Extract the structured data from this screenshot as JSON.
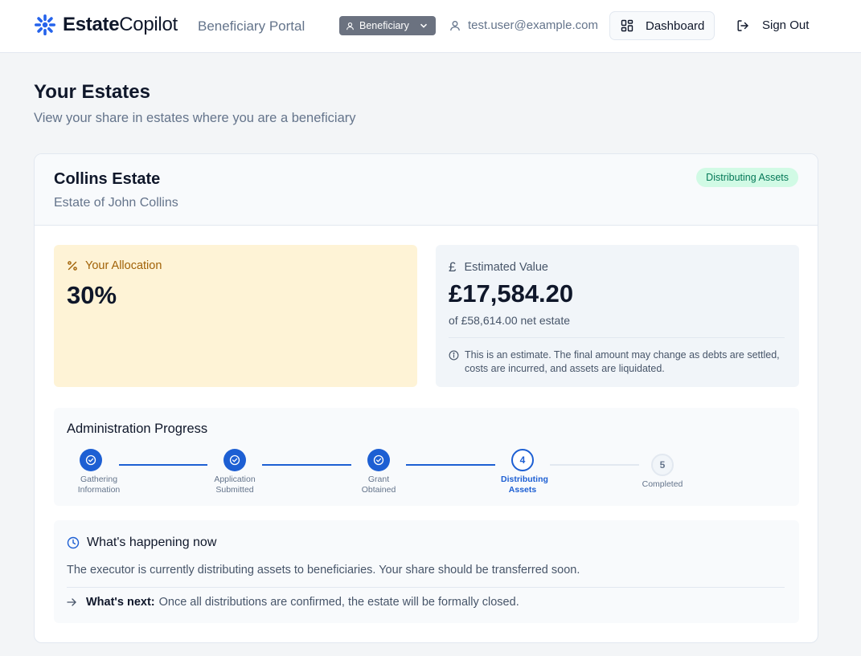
{
  "header": {
    "logo_bold": "Estate",
    "logo_light": "Copilot",
    "portal_label": "Beneficiary Portal",
    "role_label": "Beneficiary",
    "user_email": "test.user@example.com",
    "dashboard_label": "Dashboard",
    "signout_label": "Sign Out"
  },
  "page": {
    "title": "Your Estates",
    "subtitle": "View your share in estates where you are a beneficiary"
  },
  "estate": {
    "name": "Collins Estate",
    "of": "Estate of John Collins",
    "status": "Distributing Assets",
    "allocation": {
      "label": "Your Allocation",
      "value": "30%"
    },
    "estimated": {
      "label": "Estimated Value",
      "amount": "£17,584.20",
      "net": "of £58,614.00 net estate",
      "note": "This is an estimate. The final amount may change as debts are settled, costs are incurred, and assets are liquidated."
    },
    "progress": {
      "title": "Administration Progress",
      "steps": [
        {
          "num": "1",
          "label": "Gathering Information",
          "state": "done"
        },
        {
          "num": "2",
          "label": "Application Submitted",
          "state": "done"
        },
        {
          "num": "3",
          "label": "Grant Obtained",
          "state": "done"
        },
        {
          "num": "4",
          "label": "Distributing Assets",
          "state": "current"
        },
        {
          "num": "5",
          "label": "Completed",
          "state": "todo"
        }
      ]
    },
    "happening": {
      "title": "What's happening now",
      "body": "The executor is currently distributing assets to beneficiaries. Your share should be transferred soon.",
      "next_label": "What's next:",
      "next_text": "Once all distributions are confirmed, the estate will be formally closed."
    }
  },
  "colors": {
    "accent": "#1d5fd3",
    "status_bg": "#d1fae5",
    "status_fg": "#047857",
    "allocation_bg": "#fef3d6",
    "allocation_fg": "#a16207"
  }
}
